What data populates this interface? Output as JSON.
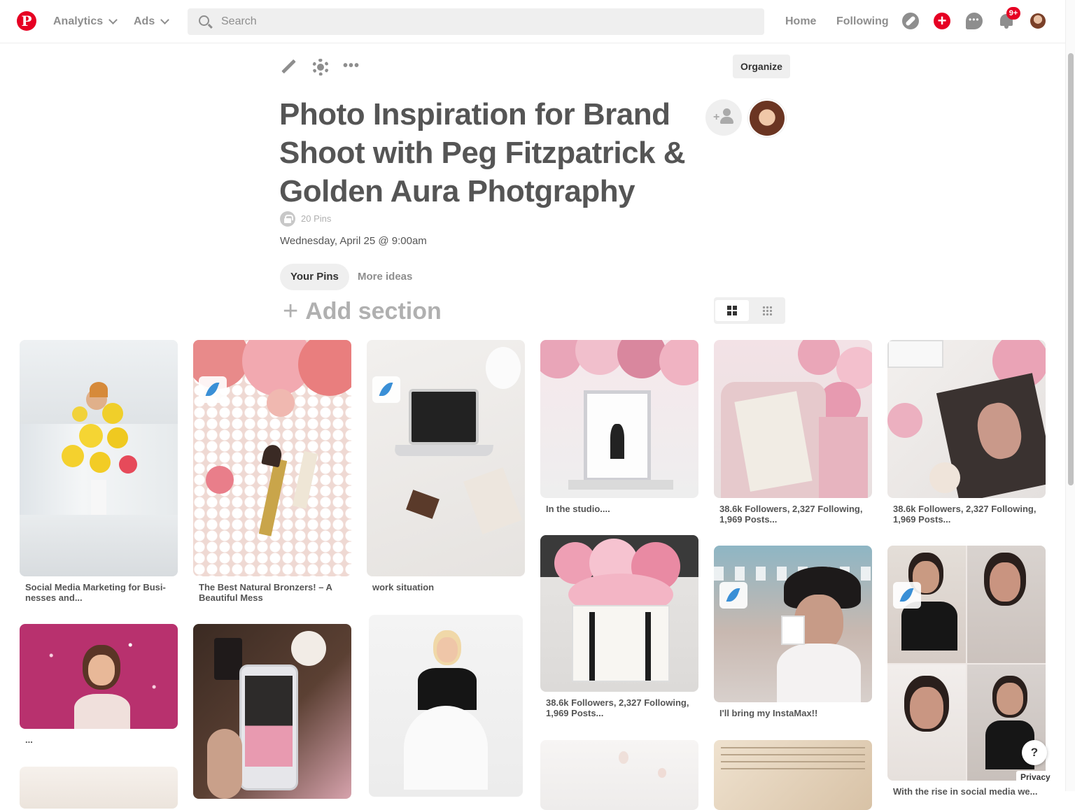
{
  "header": {
    "logo_letter": "P",
    "analytics_label": "Analytics",
    "ads_label": "Ads",
    "search_placeholder": "Search",
    "home_label": "Home",
    "following_label": "Following",
    "notification_badge": "9+",
    "icons": [
      "pinterest-logo-icon",
      "chevron-down-icon",
      "search-icon",
      "compass-icon",
      "plus-icon",
      "chat-icon",
      "bell-icon",
      "avatar"
    ]
  },
  "board": {
    "toolbar_icons": [
      "pencil-icon",
      "gear-icon",
      "more-icon"
    ],
    "more_glyph": "•••",
    "organize_label": "Organize",
    "title": "Photo Inspiration for Brand Shoot with Peg Fitzpatrick & Golden Aura Photgraphy",
    "pin_count": "20 Pins",
    "description": "Wednesday, April 25 @ 9:00am",
    "add_collaborator_glyph": "+",
    "tabs": [
      {
        "label": "Your Pins",
        "active": true
      },
      {
        "label": "More ideas",
        "active": false
      }
    ],
    "add_section_glyph": "+",
    "add_section_label": "Add section"
  },
  "pins": [
    {
      "caption": "Social Media Marketing for Busi- nesses and..."
    },
    {
      "caption": "The Best Natural Bronzers! – A Beautiful Mess"
    },
    {
      "caption": "work situation"
    },
    {
      "caption": "In the studio...."
    },
    {
      "caption": "38.6k Followers, 2,327 Following, 1,969 Posts..."
    },
    {
      "caption": "38.6k Followers, 2,327 Following, 1,969 Posts..."
    },
    {
      "caption": "..."
    },
    {
      "caption": ""
    },
    {
      "caption": ""
    },
    {
      "caption": "38.6k Followers, 2,327 Following, 1,969 Posts..."
    },
    {
      "caption": "I'll bring my InstaMax!!"
    },
    {
      "caption": "With the rise in social media we..."
    },
    {
      "caption": ""
    },
    {
      "caption": ""
    },
    {
      "caption": ""
    }
  ],
  "footer": {
    "help_label": "?",
    "privacy_label": "Privacy"
  },
  "colors": {
    "brand_red": "#e60023",
    "text_gray": "#8e8e8e",
    "title_gray": "#555555"
  }
}
